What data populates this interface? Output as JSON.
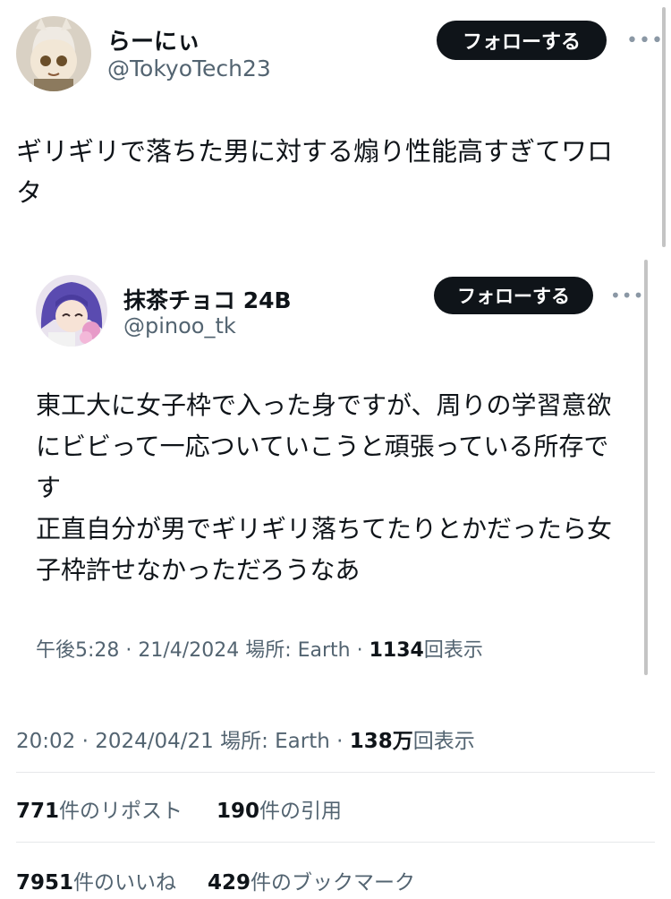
{
  "tweet": {
    "display_name": "らーにぃ",
    "handle": "@TokyoTech23",
    "follow_label": "フォローする",
    "more_label": "•••",
    "text_line1": "ギリギリで落ちた男に対する煽り性能高すぎてワロ",
    "text_line2": "タ",
    "meta_time_date": "20:02 · 2024/04/21",
    "meta_location": "場所: Earth ·",
    "meta_views_count": "138万",
    "meta_views_label": "回表示"
  },
  "quoted": {
    "display_name": "抹茶チョコ 24B",
    "handle": "@pinoo_tk",
    "follow_label": "フォローする",
    "more_label": "•••",
    "text_lines": [
      "東工大に女子枠で入った身ですが、周りの学習意欲",
      "にビビって一応ついていこうと頑張っている所存で",
      "す",
      "正直自分が男でギリギリ落ちてたりとかだったら女",
      "子枠許せなかっただろうなあ"
    ],
    "meta_time_date": "午後5:28 · 21/4/2024",
    "meta_location": "場所: Earth ·",
    "meta_views_count": "1134",
    "meta_views_label": "回表示"
  },
  "stats": {
    "reposts_count": "771",
    "reposts_label": "件のリポスト",
    "quotes_count": "190",
    "quotes_label": "件の引用",
    "likes_count": "7951",
    "likes_label": "件のいいね",
    "bookmarks_count": "429",
    "bookmarks_label": "件のブックマーク"
  },
  "colors": {
    "text": "#0f1419",
    "secondary": "#536471",
    "button_bg": "#0f1419"
  }
}
